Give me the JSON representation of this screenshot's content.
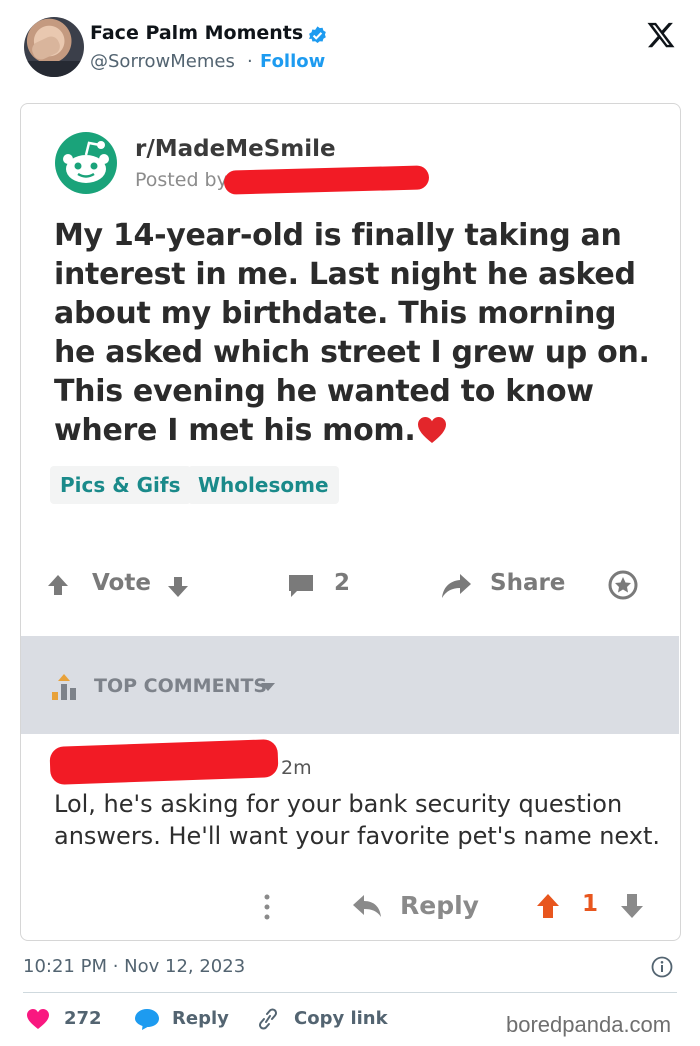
{
  "tweet": {
    "author_name": "Face Palm Moments",
    "handle": "@SorrowMemes",
    "separator": "·",
    "follow_label": "Follow",
    "timestamp": "10:21 PM · Nov 12, 2023"
  },
  "reddit_post": {
    "subreddit": "r/MadeMeSmile",
    "posted_by_label": "Posted by",
    "body": "My 14-year-old is finally taking an interest in me. Last night he asked about my birthdate. This morning he asked which street I grew up on. This evening he wanted to know where I met his mom.",
    "tags": [
      "Pics & Gifs",
      "Wholesome"
    ],
    "actions": {
      "vote_label": "Vote",
      "comment_count": "2",
      "share_label": "Share"
    },
    "top_comments_label": "TOP COMMENTS",
    "comment": {
      "time": "2m",
      "text": "Lol, he's asking for your bank security question answers. He'll want your favorite  pet's name next.",
      "reply_label": "Reply",
      "score": "1"
    }
  },
  "engagement": {
    "likes": "272",
    "reply_label": "Reply",
    "copy_link_label": "Copy link"
  },
  "watermark": "boredpanda.com",
  "colors": {
    "x_blue": "#1d9bf0",
    "reddit_teal": "#1a8a8a",
    "redaction_red": "#f21b25",
    "upvote_orange": "#e8561e",
    "like_pink": "#f91880"
  },
  "icons": [
    "verified-badge-icon",
    "x-logo-icon",
    "reddit-snoo-icon",
    "heart-emoji-icon",
    "upvote-icon",
    "downvote-icon",
    "comment-icon",
    "share-icon",
    "award-icon",
    "info-icon",
    "like-icon",
    "reply-bubble-icon",
    "link-icon"
  ]
}
